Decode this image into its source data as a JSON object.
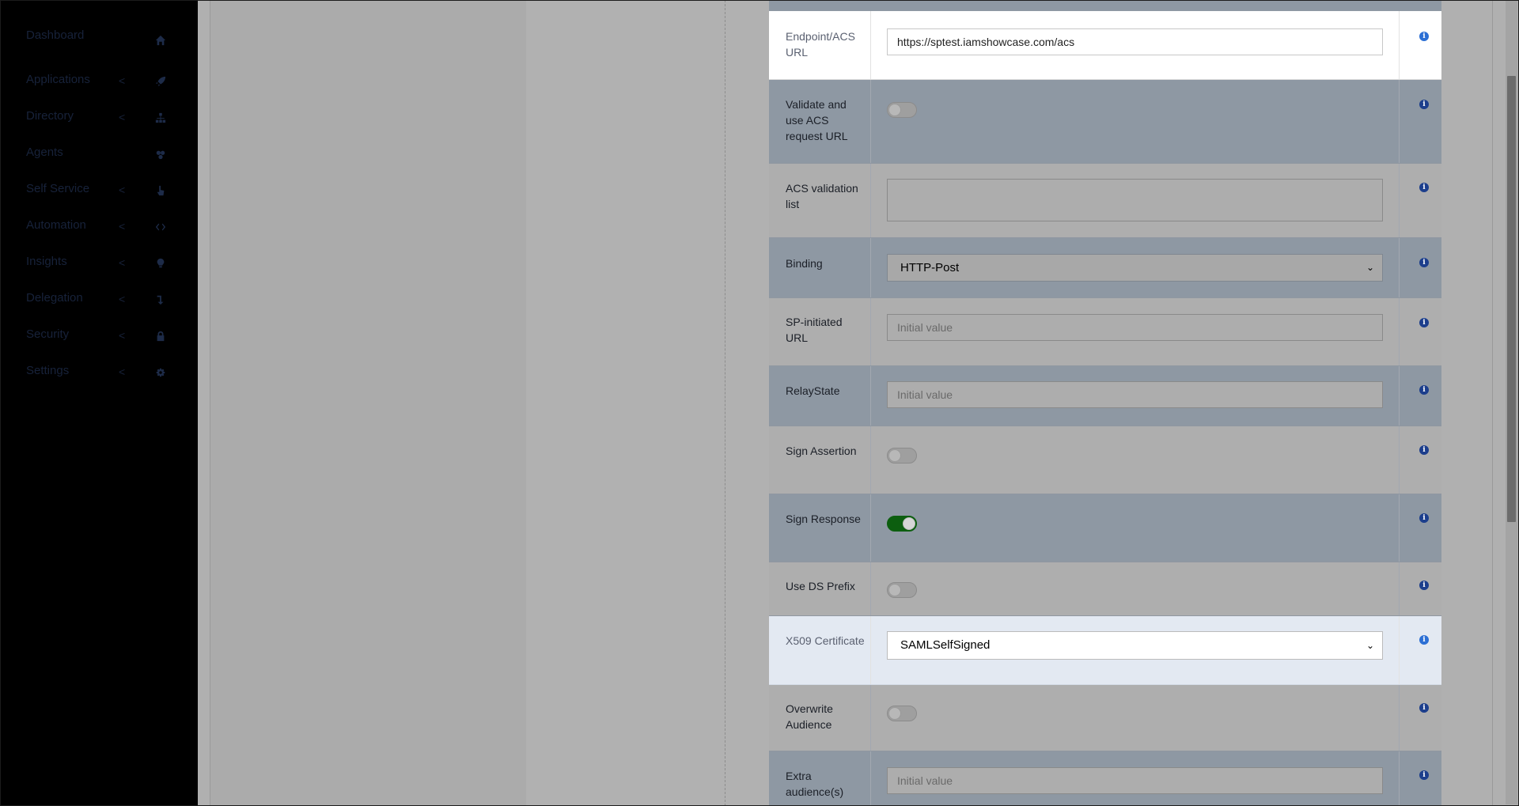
{
  "sidebar": {
    "items": [
      {
        "label": "Dashboard",
        "icon": "home-icon",
        "has_chevron": false
      },
      {
        "label": "Applications",
        "icon": "rocket-icon",
        "has_chevron": true
      },
      {
        "label": "Directory",
        "icon": "sitemap-icon",
        "has_chevron": true
      },
      {
        "label": "Agents",
        "icon": "agents-icon",
        "has_chevron": false
      },
      {
        "label": "Self Service",
        "icon": "hand-pointer-icon",
        "has_chevron": true
      },
      {
        "label": "Automation",
        "icon": "code-icon",
        "has_chevron": true
      },
      {
        "label": "Insights",
        "icon": "lightbulb-icon",
        "has_chevron": true
      },
      {
        "label": "Delegation",
        "icon": "level-down-icon",
        "has_chevron": true
      },
      {
        "label": "Security",
        "icon": "lock-icon",
        "has_chevron": true
      },
      {
        "label": "Settings",
        "icon": "gear-icon",
        "has_chevron": true
      }
    ],
    "chevron": "<"
  },
  "form": {
    "endpoint": {
      "label": "Endpoint/ACS URL",
      "value": "https://sptest.iamshowcase.com/acs"
    },
    "validate_acs": {
      "label": "Validate and use ACS request URL",
      "checked": false
    },
    "acs_validation_list": {
      "label": "ACS validation list",
      "value": ""
    },
    "binding": {
      "label": "Binding",
      "value": "HTTP-Post"
    },
    "sp_initiated_url": {
      "label": "SP-initiated URL",
      "placeholder": "Initial value"
    },
    "relay_state": {
      "label": "RelayState",
      "placeholder": "Initial value"
    },
    "sign_assertion": {
      "label": "Sign Assertion",
      "checked": false
    },
    "sign_response": {
      "label": "Sign Response",
      "checked": true
    },
    "use_ds_prefix": {
      "label": "Use DS Prefix",
      "checked": false
    },
    "x509_certificate": {
      "label": "X509 Certificate",
      "value": "SAMLSelfSigned"
    },
    "overwrite_audience": {
      "label": "Overwrite Audience",
      "checked": false
    },
    "extra_audiences": {
      "label": "Extra audience(s)",
      "placeholder": "Initial value"
    }
  },
  "info_glyph": "i",
  "select_chevron": "⌄",
  "colors": {
    "toggle_on": "#0c5e0f",
    "info_icon": "#1c3e8c",
    "sidebar_bg": "#000000"
  }
}
